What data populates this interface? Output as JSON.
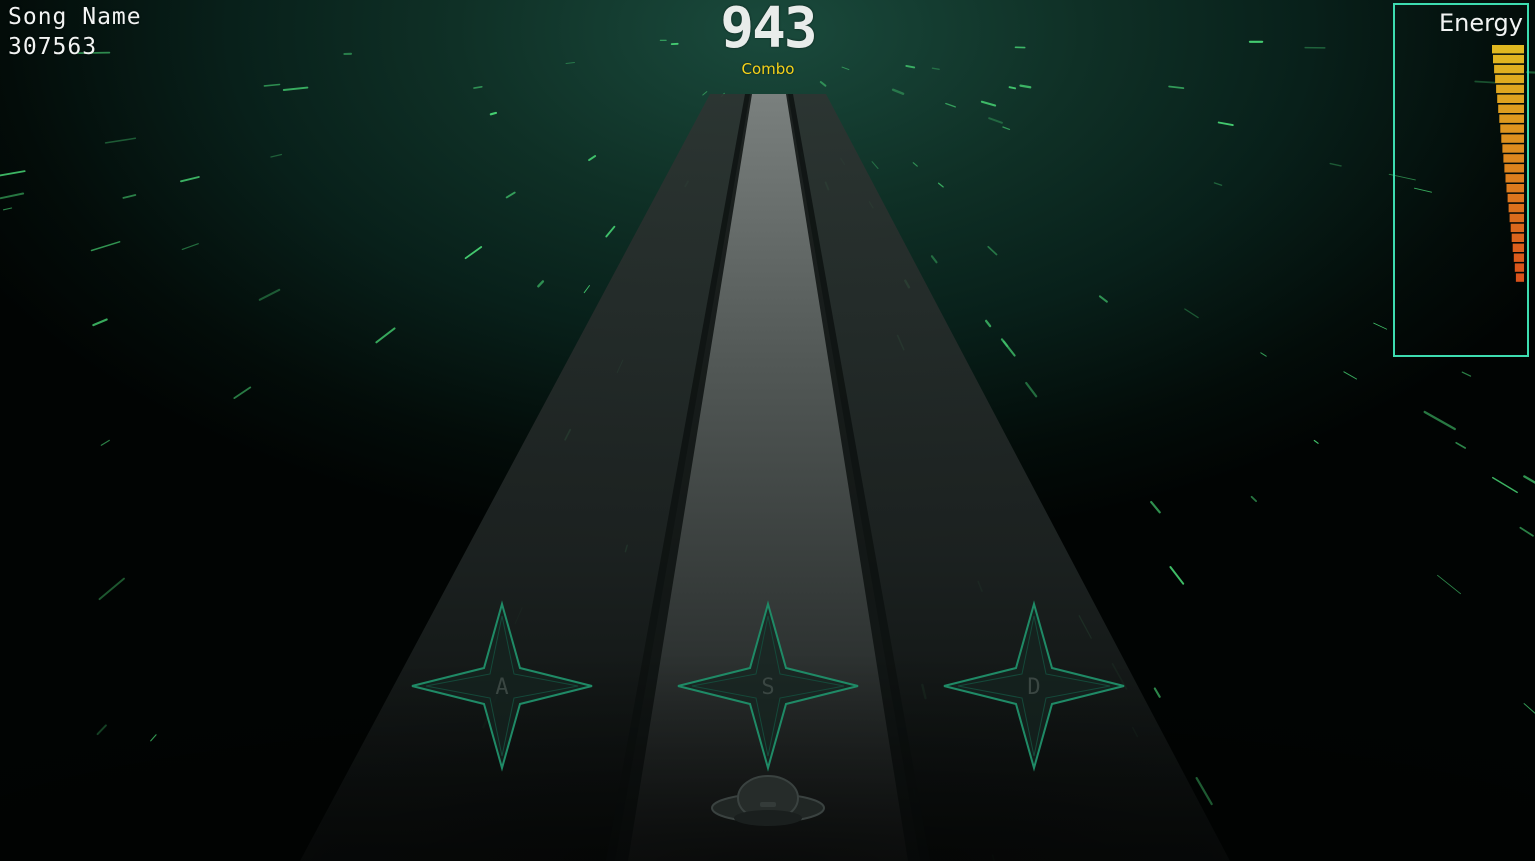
{
  "hud": {
    "song_name": "Song Name",
    "score": "307563",
    "combo_count": "943",
    "combo_label": "Combo",
    "energy_label": "Energy"
  },
  "energy": {
    "level": 0.85,
    "colors": {
      "top": "#e0b820",
      "bottom": "#d8401a",
      "frame": "#3ddcb0"
    }
  },
  "lanes": [
    {
      "key": "A"
    },
    {
      "key": "S"
    },
    {
      "key": "D"
    }
  ],
  "colors": {
    "accent": "#3ddcb0",
    "combo_label": "#f5d21a",
    "star_streak": "#4be07a"
  },
  "icons": {
    "player_ship": "ufo-icon",
    "hit_target": "four-point-star-icon"
  }
}
